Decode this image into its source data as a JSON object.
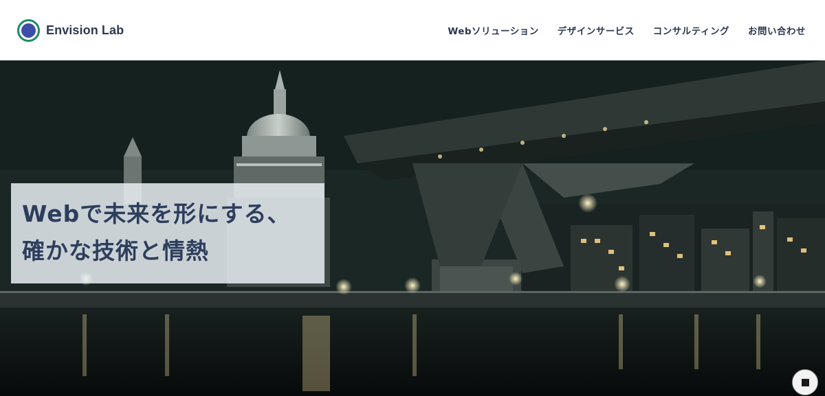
{
  "header": {
    "brand": {
      "name": "Envision Lab",
      "logo_icon": "circle-logo-icon",
      "logo_ring_color": "#1c8a68",
      "logo_dot_color": "#3d4ea8"
    },
    "nav": [
      {
        "label": "Webソリューション"
      },
      {
        "label": "デザインサービス"
      },
      {
        "label": "コンサルティング"
      },
      {
        "label": "お問い合わせ"
      }
    ]
  },
  "hero": {
    "headline_line1": "Webで未来を形にする、",
    "headline_line2": "確かな技術と情熱",
    "background": "night-city-bridge-photo",
    "stop_button": {
      "icon": "stop-icon"
    }
  },
  "colors": {
    "text": "#2d3e5c",
    "header_bg": "#ffffff",
    "hero_dark": "#1c2a28",
    "lights": "#ffe9a8"
  }
}
